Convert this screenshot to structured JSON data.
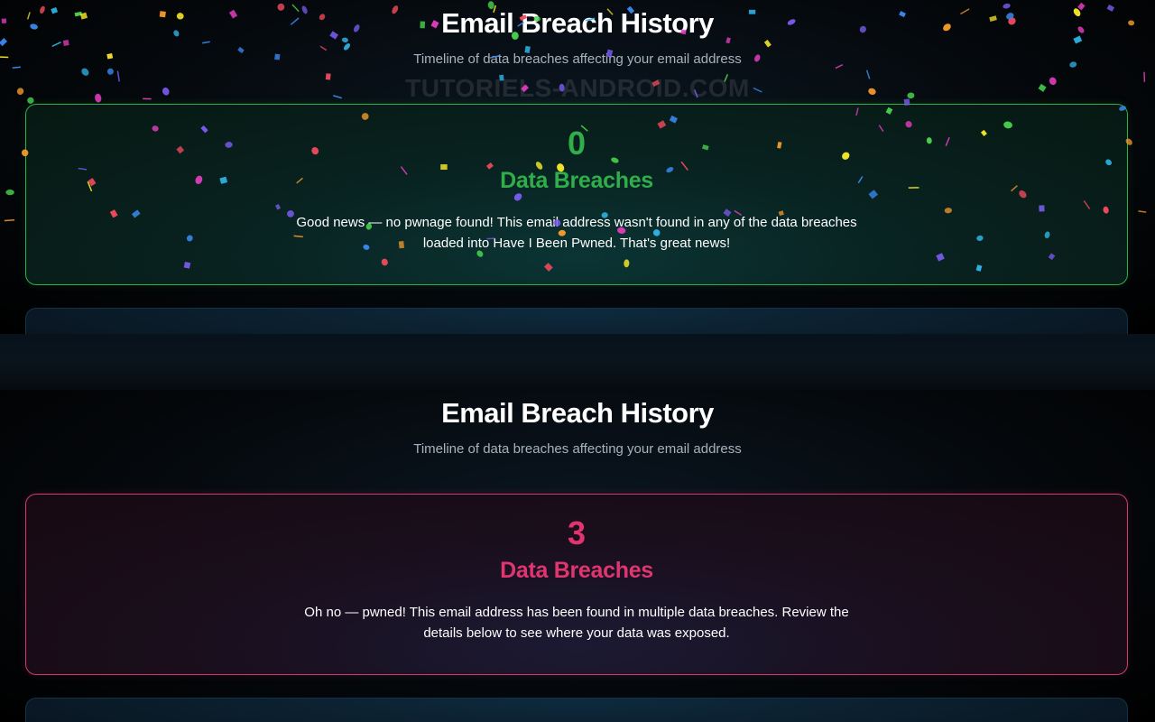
{
  "watermark": "TUTORIELS-ANDROID.COM",
  "top": {
    "title": "Email Breach History",
    "subtitle": "Timeline of data breaches affecting your email address",
    "card": {
      "count": "0",
      "label": "Data Breaches",
      "message": "Good news — no pwnage found! This email address wasn't found in any of the data breaches loaded into Have I Been Pwned. That's great news!",
      "accent_color": "#2fae4a"
    }
  },
  "bottom": {
    "title": "Email Breach History",
    "subtitle": "Timeline of data breaches affecting your email address",
    "card": {
      "count": "3",
      "label": "Data Breaches",
      "message": "Oh no — pwned! This email address has been found in multiple data breaches. Review the details below to see where your data was exposed.",
      "accent_color": "#e0356f"
    }
  },
  "confetti_colors": [
    "#e63dbf",
    "#7b5cf0",
    "#2fb5e8",
    "#f2e42a",
    "#47d14b",
    "#f24a5e",
    "#f29a2a",
    "#3a8af0"
  ]
}
